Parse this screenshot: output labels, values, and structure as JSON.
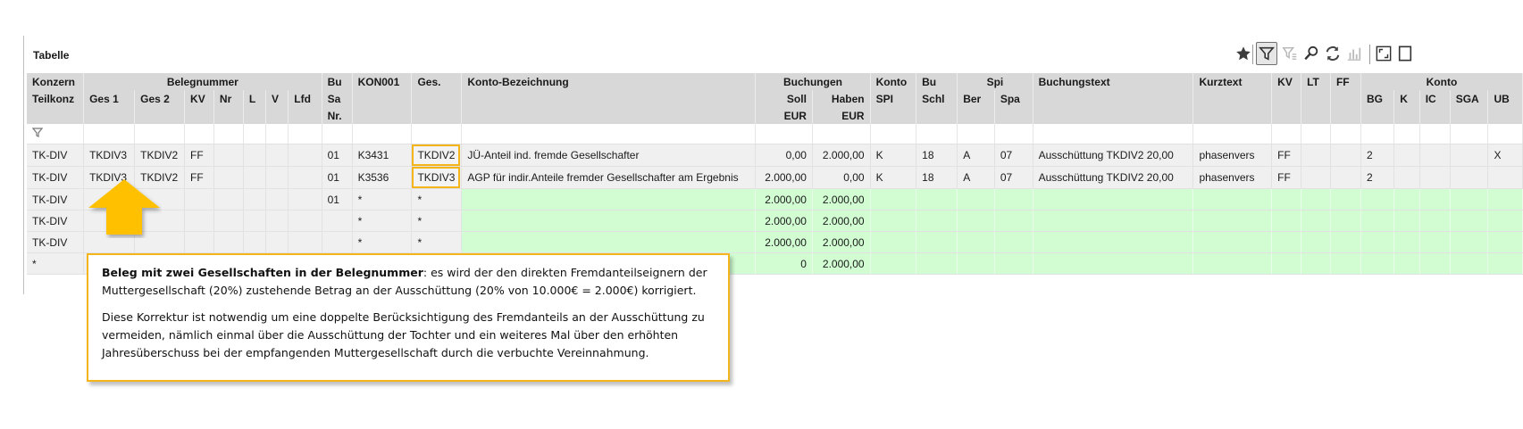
{
  "panel": {
    "title": "Tabelle"
  },
  "toolbar": [
    {
      "name": "favorite-star-icon",
      "glyph": "★",
      "state": "normal"
    },
    {
      "name": "filter-icon",
      "glyph": "⛛",
      "state": "active"
    },
    {
      "name": "filter-clear-icon",
      "glyph": "⛛",
      "state": "disabled"
    },
    {
      "name": "search-icon",
      "glyph": "⌕",
      "state": "normal"
    },
    {
      "name": "refresh-icon",
      "glyph": "⇄",
      "state": "normal"
    },
    {
      "name": "chart-icon",
      "glyph": "▥",
      "state": "disabled"
    },
    {
      "name": "expand-icon",
      "glyph": "⛶",
      "state": "normal"
    },
    {
      "name": "panel-icon",
      "glyph": "▯",
      "state": "normal"
    }
  ],
  "headers": {
    "group_row": [
      "Konzern",
      "Belegnummer",
      "Bu",
      "KON001",
      "Ges.",
      "Konto-Bezeichnung",
      "Buchungen",
      "Konto",
      "Bu",
      "Spi",
      "Buchungstext",
      "Kurztext",
      "KV",
      "LT",
      "FF",
      "Konto"
    ],
    "row2": [
      "Teilkonz",
      "Ges 1",
      "Ges 2",
      "KV",
      "Nr",
      "L",
      "V",
      "Lfd",
      "Sa",
      "Soll",
      "Haben",
      "SPI",
      "Schl",
      "Ber",
      "Spa",
      "BG",
      "K",
      "IC",
      "SGA",
      "UB"
    ],
    "row3": [
      "Nr.",
      "EUR",
      "EUR"
    ]
  },
  "rows": [
    {
      "teilkonz": "TK-DIV",
      "ges1": "TKDIV3",
      "ges2": "TKDIV2",
      "kv": "FF",
      "nr": "",
      "l": "",
      "v": "",
      "lfd": "",
      "busa": "01",
      "kon001": "K3431",
      "ges": "TKDIV2",
      "bezeichnung": "JÜ-Anteil ind. fremde Gesellschafter",
      "soll": "0,00",
      "haben": "2.000,00",
      "spi": "K",
      "schl": "18",
      "ber": "A",
      "spa": "07",
      "buchungstext": "Ausschüttung  TKDIV2  20,00",
      "kurztext": "phasenvers",
      "kv2": "FF",
      "lt": "",
      "ff": "",
      "bg": "2",
      "k": "",
      "ic": "",
      "sga": "",
      "ub": "X",
      "green": false
    },
    {
      "teilkonz": "TK-DIV",
      "ges1": "TKDIV3",
      "ges2": "TKDIV2",
      "kv": "FF",
      "nr": "",
      "l": "",
      "v": "",
      "lfd": "",
      "busa": "01",
      "kon001": "K3536",
      "ges": "TKDIV3",
      "bezeichnung": "AGP für indir.Anteile fremder Gesellschafter am Ergebnis",
      "soll": "2.000,00",
      "haben": "0,00",
      "spi": "K",
      "schl": "18",
      "ber": "A",
      "spa": "07",
      "buchungstext": "Ausschüttung  TKDIV2  20,00",
      "kurztext": "phasenvers",
      "kv2": "FF",
      "lt": "",
      "ff": "",
      "bg": "2",
      "k": "",
      "ic": "",
      "sga": "",
      "ub": "",
      "green": false
    },
    {
      "teilkonz": "TK-DIV",
      "busa": "01",
      "kon001": "*",
      "ges": "*",
      "soll": "2.000,00",
      "haben": "2.000,00",
      "green": true
    },
    {
      "teilkonz": "TK-DIV",
      "busa": "",
      "kon001": "*",
      "ges": "*",
      "soll": "2.000,00",
      "haben": "2.000,00",
      "green": true
    },
    {
      "teilkonz": "TK-DIV",
      "busa": "",
      "kon001": "*",
      "ges": "*",
      "soll": "2.000,00",
      "haben": "2.000,00",
      "green": true
    },
    {
      "teilkonz": "*",
      "busa": "",
      "kon001": "",
      "ges": "",
      "soll": "0",
      "haben": "2.000,00",
      "green": true
    }
  ],
  "callout": {
    "bold": "Beleg mit zwei Gesellschaften in der Belegnummer",
    "p1_rest": ": es wird der den direkten Fremdanteilseignern der Muttergesellschaft (20%) zustehende Betrag an der Ausschüttung (20% von 10.000€ = 2.000€) korrigiert.",
    "p2": "Diese Korrektur ist notwendig um eine doppelte Berücksichtigung des Fremdanteils an der Ausschüttung zu vermeiden, nämlich einmal über die Ausschüttung der Tochter und ein weiteres Mal über den erhöhten Jahresüberschuss bei der empfangenden Muttergesellschaft durch die verbuchte Vereinnahmung."
  },
  "colors": {
    "highlight": "#f3b51a",
    "green_row": "#d2fdd2",
    "header_bg": "#d8d8d8",
    "arrow": "#ffc000"
  }
}
